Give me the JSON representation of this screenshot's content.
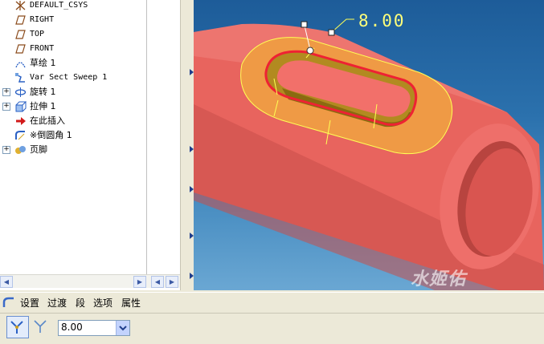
{
  "model_tree": {
    "items": [
      {
        "label": "DEFAULT_CSYS",
        "icon": "csys-icon",
        "expandable": false,
        "mono": true
      },
      {
        "label": "RIGHT",
        "icon": "datum-plane-icon",
        "expandable": false,
        "mono": true
      },
      {
        "label": "TOP",
        "icon": "datum-plane-icon",
        "expandable": false,
        "mono": true
      },
      {
        "label": "FRONT",
        "icon": "datum-plane-icon",
        "expandable": false,
        "mono": true
      },
      {
        "label": "草绘 1",
        "icon": "sketch-icon",
        "expandable": false,
        "mono": false
      },
      {
        "label": "Var Sect Sweep 1",
        "icon": "sweep-icon",
        "expandable": false,
        "mono": true
      },
      {
        "label": "旋转 1",
        "icon": "revolve-icon",
        "expandable": true,
        "mono": false
      },
      {
        "label": "拉伸 1",
        "icon": "extrude-icon",
        "expandable": true,
        "mono": false
      },
      {
        "label": "在此插入",
        "icon": "insert-here-arrow-icon",
        "expandable": false,
        "mono": false
      },
      {
        "label": "※倒圆角 1",
        "icon": "round-icon",
        "expandable": false,
        "mono": false
      },
      {
        "label": "页脚",
        "icon": "footer-icon",
        "expandable": true,
        "mono": false
      }
    ]
  },
  "viewport": {
    "dimension_value": "8.00",
    "watermark": "水姬佑"
  },
  "dashboard": {
    "menu": [
      "设置",
      "过渡",
      "段",
      "选项",
      "属性"
    ],
    "radius_value": "8.00"
  },
  "colors": {
    "part_body": "#f26b66",
    "round_highlight": "#ee2233",
    "edge_yellow": "#ffff55",
    "background_top": "#1d5c99"
  }
}
